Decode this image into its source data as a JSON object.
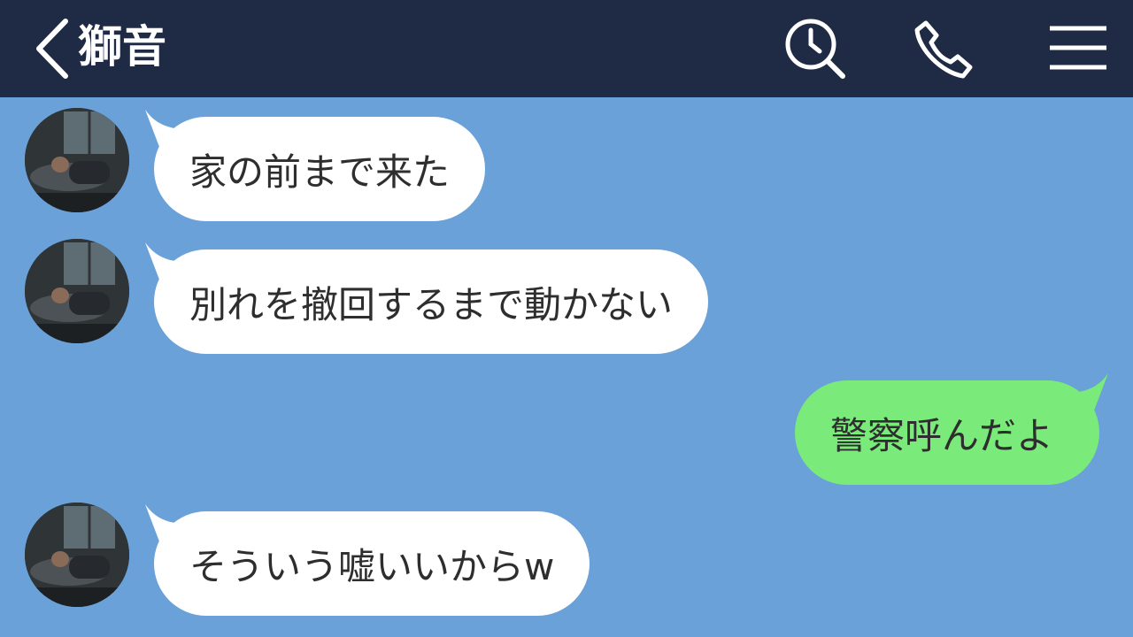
{
  "header": {
    "title": "獅音",
    "back_icon": "chevron-left-icon",
    "search_icon": "clock-search-icon",
    "call_icon": "phone-icon",
    "menu_icon": "hamburger-menu-icon"
  },
  "colors": {
    "header_bg": "#1f2a44",
    "chat_bg": "#6aa1d8",
    "incoming_bubble": "#ffffff",
    "outgoing_bubble": "#7aeb7a"
  },
  "messages": [
    {
      "direction": "incoming",
      "text": "家の前まで来た"
    },
    {
      "direction": "incoming",
      "text": "別れを撤回するまで動かない"
    },
    {
      "direction": "outgoing",
      "text": "警察呼んだよ"
    },
    {
      "direction": "incoming",
      "text": "そういう嘘いいからw"
    }
  ]
}
